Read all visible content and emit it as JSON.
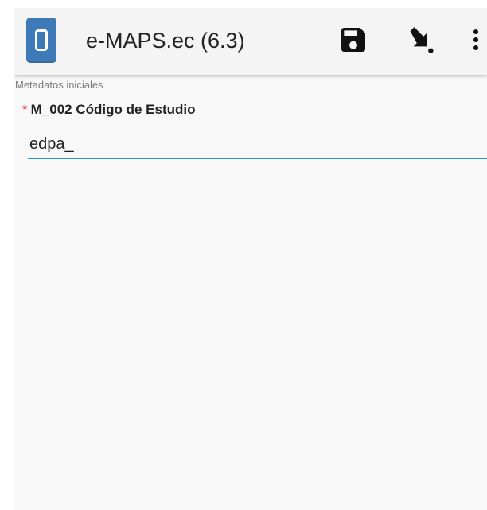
{
  "app": {
    "title": "e-MAPS.ec (6.3)",
    "accent_color": "#3f7ab8"
  },
  "toolbar": {
    "actions": [
      {
        "icon": "save-icon",
        "label": "Guardar"
      },
      {
        "icon": "download-arrow-icon",
        "label": "Ir a"
      },
      {
        "icon": "more-vert-icon",
        "label": "Más opciones"
      }
    ]
  },
  "form": {
    "section_label": "Metadatos iniciales",
    "field": {
      "required_marker": "*",
      "label": "M_002 Código de Estudio",
      "value": "edpa_",
      "underline_color": "#2f8fe0",
      "required_color": "#e53935"
    }
  }
}
